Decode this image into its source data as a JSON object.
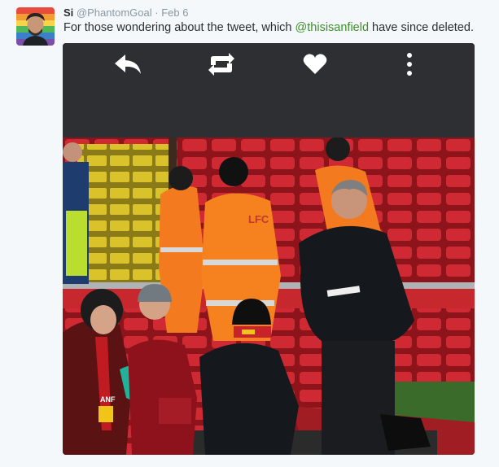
{
  "tweet": {
    "display_name": "Si",
    "handle": "@PhantomGoal",
    "separator": "·",
    "date": "Feb 6",
    "text_before": "For those wondering about the tweet, which ",
    "mention": "@thisisanfield",
    "text_after": " have since deleted."
  },
  "media_actions": {
    "reply_icon": "reply-arrow-icon",
    "retweet_icon": "retweet-icon",
    "like_icon": "heart-icon",
    "more_icon": "more-vertical-icon"
  },
  "photo": {
    "jacket_text": "LFC",
    "scarf_text": "ANF"
  },
  "colors": {
    "mention": "#3f8f2c",
    "media_bar": "#2d2f32",
    "stadium_seats": "#c8242c",
    "hi_vis_orange": "#f47a20"
  }
}
